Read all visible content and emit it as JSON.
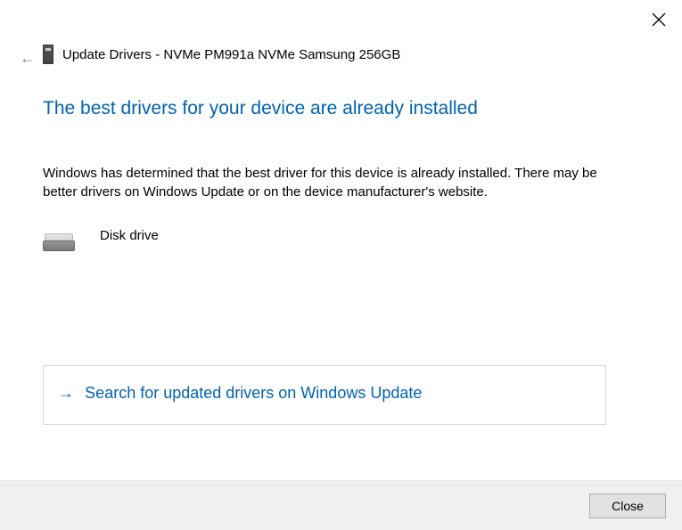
{
  "window": {
    "title": "Update Drivers - NVMe PM991a NVMe Samsung 256GB"
  },
  "main": {
    "heading": "The best drivers for your device are already installed",
    "body": "Windows has determined that the best driver for this device is already installed. There may be better drivers on Windows Update or on the device manufacturer's website.",
    "device_label": "Disk drive"
  },
  "action_link": {
    "label": "Search for updated drivers on Windows Update"
  },
  "footer": {
    "close_label": "Close"
  },
  "icons": {
    "close": "close-icon",
    "back": "back-arrow-icon",
    "device": "device-icon",
    "disk": "disk-drive-icon",
    "arrow_right": "arrow-right-icon"
  }
}
